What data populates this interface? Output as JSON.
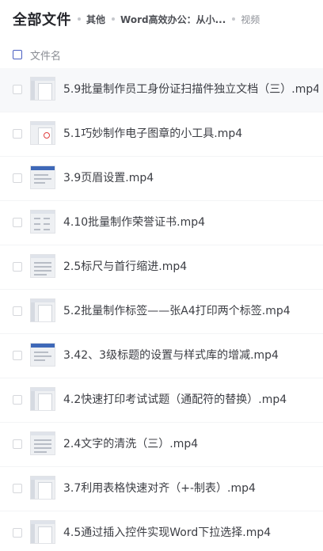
{
  "breadcrumb": {
    "root": "全部文件",
    "level1": "其他",
    "level2": "Word高效办公：从小...",
    "current": "视频"
  },
  "list_header": {
    "column_label": "文件名"
  },
  "files": [
    {
      "name": "5.9批量制作员工身份证扫描件独立文档（三）.mp4",
      "thumb_icon": "video-thumbnail-icon"
    },
    {
      "name": "5.1巧妙制作电子图章的小工具.mp4",
      "thumb_icon": "video-thumbnail-icon"
    },
    {
      "name": "3.9页眉设置.mp4",
      "thumb_icon": "video-thumbnail-icon"
    },
    {
      "name": "4.10批量制作荣誉证书.mp4",
      "thumb_icon": "video-thumbnail-icon"
    },
    {
      "name": "2.5标尺与首行缩进.mp4",
      "thumb_icon": "video-thumbnail-icon"
    },
    {
      "name": "5.2批量制作标签——张A4打印两个标签.mp4",
      "thumb_icon": "video-thumbnail-icon"
    },
    {
      "name": "3.42、3级标题的设置与样式库的增减.mp4",
      "thumb_icon": "video-thumbnail-icon"
    },
    {
      "name": "4.2快速打印考试试题（通配符的替换）.mp4",
      "thumb_icon": "video-thumbnail-icon"
    },
    {
      "name": "2.4文字的清洗（三）.mp4",
      "thumb_icon": "video-thumbnail-icon"
    },
    {
      "name": "3.7利用表格快速对齐（+-制表）.mp4",
      "thumb_icon": "video-thumbnail-icon"
    },
    {
      "name": "4.5通过插入控件实现Word下拉选择.mp4",
      "thumb_icon": "video-thumbnail-icon"
    }
  ],
  "colors": {
    "accent": "#4a5fc1",
    "title": "#25262b",
    "text": "#3c3e44",
    "muted": "#8a8d94"
  }
}
